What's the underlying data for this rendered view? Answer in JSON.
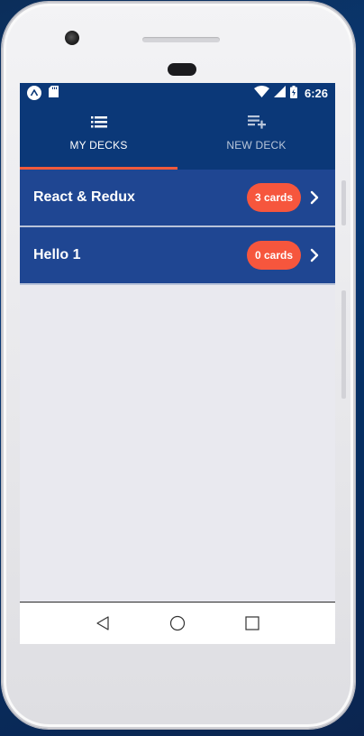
{
  "status_bar": {
    "time": "6:26",
    "left_icons": [
      "expo-icon",
      "sd-card-icon"
    ],
    "right_icons": [
      "wifi-icon",
      "cell-signal-icon",
      "battery-charging-icon"
    ]
  },
  "tabs": [
    {
      "label": "MY DECKS",
      "icon": "list-icon",
      "active": true
    },
    {
      "label": "NEW DECK",
      "icon": "playlist-add-icon",
      "active": false
    }
  ],
  "colors": {
    "header": "#0b3878",
    "row": "#1f4692",
    "badge": "#f6563d",
    "indicator": "#f05a3c",
    "background": "#e9e9ef"
  },
  "decks": [
    {
      "title": "React & Redux",
      "count": "3 cards"
    },
    {
      "title": "Hello 1",
      "count": "0 cards"
    }
  ],
  "nav_bar": {
    "buttons": [
      "back-icon",
      "home-icon",
      "recents-icon"
    ]
  }
}
